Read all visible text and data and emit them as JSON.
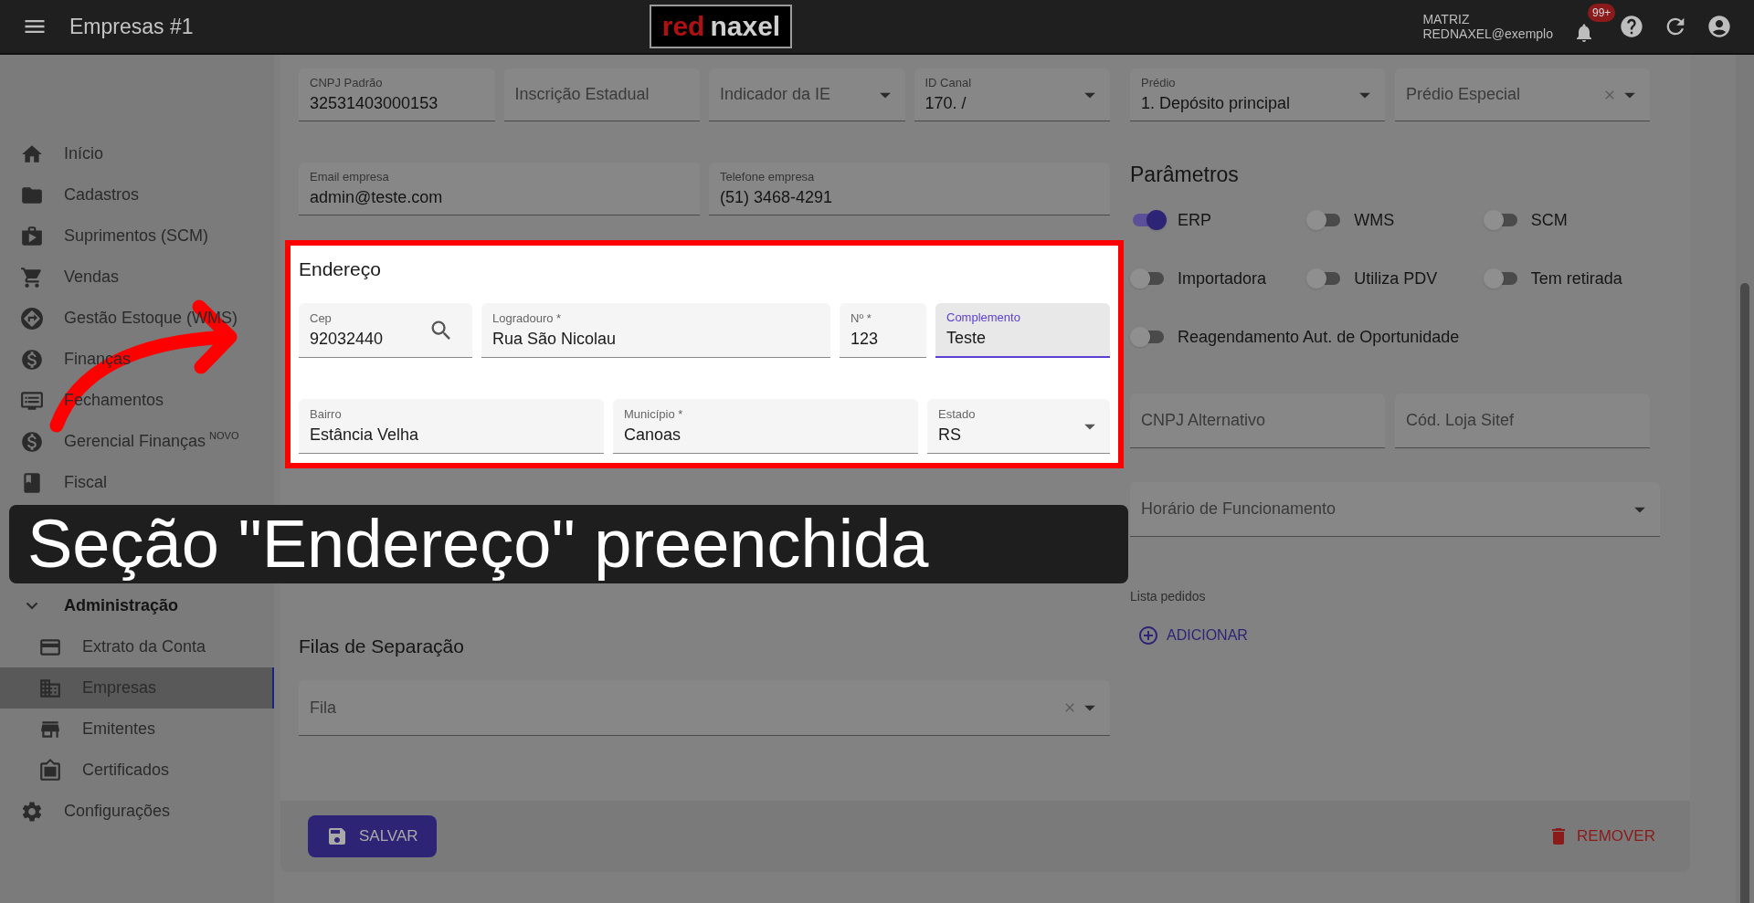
{
  "app_bar": {
    "title": "Empresas #1",
    "logo": [
      "red",
      "naxel"
    ],
    "account": [
      "MATRIZ",
      "REDNAXEL@exemplo"
    ],
    "notification_badge": "99+"
  },
  "sidebar": {
    "items": [
      {
        "kind": "link",
        "label": "Início",
        "selected": false
      },
      {
        "kind": "link",
        "label": "Cadastros",
        "selected": false
      },
      {
        "kind": "link",
        "label": "Suprimentos (SCM)",
        "selected": false
      },
      {
        "kind": "link",
        "label": "Vendas",
        "selected": false
      },
      {
        "kind": "link",
        "label": "Gestão Estoque (WMS)",
        "selected": false
      },
      {
        "kind": "link",
        "label": "Finanças",
        "selected": false
      },
      {
        "kind": "link",
        "label": "Fechamentos",
        "selected": false
      },
      {
        "kind": "link",
        "label": "Gerencial Finanças",
        "badge": "NOVO",
        "selected": false
      },
      {
        "kind": "link",
        "label": "Fiscal",
        "selected": false
      },
      {
        "kind": "group",
        "label": "Administração",
        "expanded": true,
        "selected": false,
        "children": [
          {
            "label": "Extrato da Conta",
            "selected": false
          },
          {
            "label": "Empresas",
            "selected": true
          },
          {
            "label": "Emitentes",
            "selected": false
          },
          {
            "label": "Certificados",
            "selected": false
          }
        ]
      },
      {
        "kind": "link",
        "label": "Configurações",
        "selected": false
      }
    ]
  },
  "form": {
    "fields_top": [
      {
        "label": "CNPJ Padrão",
        "value": "32531403000153"
      },
      {
        "label": "Inscrição Estadual"
      },
      {
        "kind": "select",
        "label": "Indicador da IE"
      },
      {
        "kind": "select",
        "label": "ID Canal",
        "value": "170. /"
      }
    ],
    "fields_contact": [
      {
        "label": "Email empresa",
        "value": "admin@teste.com"
      },
      {
        "label": "Telefone empresa",
        "value": "(51) 3468-4291"
      }
    ],
    "address": {
      "title": "Endereço",
      "fields": [
        {
          "kind": "search",
          "label": "Cep",
          "value": "92032440",
          "focused": false
        },
        {
          "label": "Logradouro *",
          "value": "Rua São Nicolau",
          "focused": false
        },
        {
          "label": "Nº *",
          "value": "123",
          "focused": false
        },
        {
          "label": "Complemento",
          "value": "Teste",
          "focused": true
        },
        {
          "label": "Bairro",
          "value": "Estância Velha",
          "focused": false
        },
        {
          "label": "Município *",
          "value": "Canoas",
          "focused": false
        },
        {
          "kind": "select",
          "label": "Estado",
          "value": "RS",
          "focused": false
        }
      ]
    },
    "separation": {
      "title": "Filas de Separação",
      "field": {
        "kind": "select_clearable",
        "label": "Fila"
      }
    }
  },
  "right": {
    "fields_top": [
      {
        "kind": "select",
        "label": "Prédio",
        "value": "1. Depósito principal"
      },
      {
        "kind": "select_clearable",
        "label": "Prédio Especial"
      }
    ],
    "parameters": {
      "title": "Parâmetros",
      "toggles": [
        {
          "label": "ERP",
          "on": true
        },
        {
          "label": "WMS",
          "on": false
        },
        {
          "label": "SCM",
          "on": false
        },
        {
          "label": "Importadora",
          "on": false
        },
        {
          "label": "Utiliza PDV",
          "on": false
        },
        {
          "label": "Tem retirada",
          "on": false
        },
        {
          "label": "Reagendamento Aut. de Oportunidade",
          "on": false
        }
      ]
    },
    "fields": [
      {
        "label": "CNPJ Alternativo"
      },
      {
        "label": "Cód. Loja Sitef"
      }
    ],
    "schedule_field": {
      "kind": "select",
      "label": "Horário de Funcionamento"
    },
    "orders": {
      "label": "Lista pedidos",
      "add_button": "ADICIONAR"
    }
  },
  "actions": {
    "save": "SALVAR",
    "remove": "REMOVER"
  },
  "caption": "Seção \"Endereço\" preenchida"
}
